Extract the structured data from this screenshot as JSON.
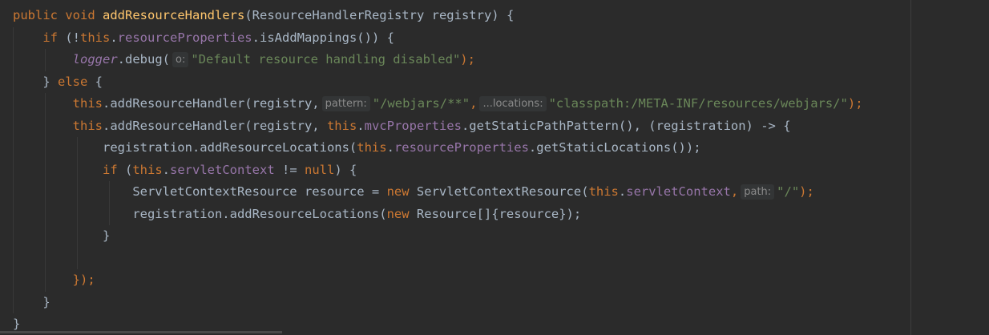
{
  "editor": {
    "theme": "darcula",
    "background": "#2b2b2b",
    "colors": {
      "keyword": "#cc7832",
      "method_decl": "#ffc66d",
      "field": "#9876aa",
      "string": "#6a8759",
      "default": "#a9b7c6"
    }
  },
  "code": {
    "l1": {
      "kw1": "public",
      "kw2": "void",
      "method": "addResourceHandlers",
      "rest": "(ResourceHandlerRegistry registry) {"
    },
    "l2": {
      "kw": "if",
      "t1": " (!",
      "this": "this",
      "t2": ".",
      "field": "resourceProperties",
      "t3": ".isAddMappings()) {"
    },
    "l3": {
      "logger": "logger",
      "t1": ".debug(",
      "hint": "o:",
      "str": "\"Default resource handling disabled\"",
      "t2": ");"
    },
    "l4": {
      "t1": "} ",
      "kw": "else",
      "t2": " {"
    },
    "l5": {
      "this": "this",
      "t1": ".addResourceHandler(registry,",
      "hint1": "pattern:",
      "str1": "\"/webjars/**\"",
      "comma": ",",
      "hint2": "...locations:",
      "str2": "\"classpath:/META-INF/resources/webjars/\"",
      "t2": ");"
    },
    "l6": {
      "this1": "this",
      "t1": ".addResourceHandler(registry, ",
      "this2": "this",
      "t2": ".",
      "field": "mvcProperties",
      "t3": ".getStaticPathPattern(), (registration) -> {"
    },
    "l7": {
      "t1": "registration.addResourceLocations(",
      "this": "this",
      "t2": ".",
      "field": "resourceProperties",
      "t3": ".getStaticLocations());"
    },
    "l8": {
      "kw": "if",
      "t1": " (",
      "this": "this",
      "t2": ".",
      "field": "servletContext",
      "t3": " != ",
      "null": "null",
      "t4": ") {"
    },
    "l9": {
      "t1": "ServletContextResource resource = ",
      "new": "new",
      "t2": " ServletContextResource(",
      "this": "this",
      "t3": ".",
      "field": "servletContext",
      "t4": ",",
      "hint": "path:",
      "str": "\"/\"",
      "t5": ");"
    },
    "l10": {
      "t1": "registration.addResourceLocations(",
      "new": "new",
      "t2": " Resource[]{resource});"
    },
    "l11": {
      "t1": "}"
    },
    "l13": {
      "t1": "});"
    },
    "l14": {
      "t1": "}"
    },
    "l15": {
      "t1": "}"
    }
  }
}
